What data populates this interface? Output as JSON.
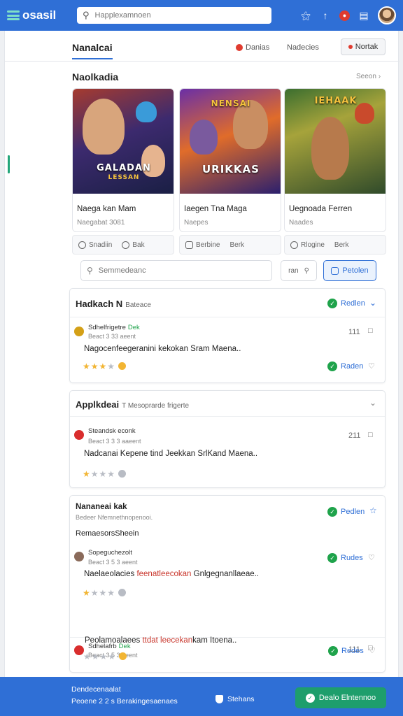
{
  "topbar": {
    "logo": "osasil",
    "search_placeholder": "Happlexamnoen",
    "notif_count": "1"
  },
  "subnav": {
    "title": "Nanalcai",
    "tab1": "Danias",
    "tab2": "Nadecies",
    "button": "Nortak"
  },
  "featured": {
    "heading": "Naolkadia",
    "see_all": "Seeon ›",
    "cards": [
      {
        "art_title": "GALADAN",
        "art_sub": "LESSAN",
        "name": "Naega kan Mam",
        "sub": "Naegabat 3081",
        "action1": "Snadiin",
        "action2": "Bak"
      },
      {
        "art_title": "URIKKAS",
        "art_sub": "NENSAI",
        "name": "Iaegen Tna Maga",
        "sub": "Naepes",
        "action1": "Berbine",
        "action2": "Berk"
      },
      {
        "art_title": "IEHAAK",
        "art_sub": "",
        "name": "Uegnoada Ferren",
        "sub": "Naades",
        "action1": "Rlogine",
        "action2": "Berk"
      }
    ]
  },
  "toolbar": {
    "search_placeholder": "Semmedeanc",
    "filter_label": "ran",
    "preview_label": "Petolen"
  },
  "panel1": {
    "title": "Hadkach N",
    "tag": "Bateace",
    "status": "Redlen",
    "review": {
      "name": "Sdhelfrigetre",
      "name_tag": "Dek",
      "meta": "Beact 3 33 aeent",
      "text": "Nagocenfeegeranini kekokan Sram Maena..",
      "count": "111",
      "status": "Raden",
      "stars": 3
    }
  },
  "panel2": {
    "title": "Applkdeai",
    "tag": "T   Mesoprarde frigerte",
    "review": {
      "name": "Steandsk econk",
      "meta": "Beact 3 3 3 aaeent",
      "text": "Nadcanai Kepene tind Jeekkan SrlKand Maena..",
      "count": "211",
      "stars": 1
    }
  },
  "panel3": {
    "title": "Nananeai kak",
    "meta": "Bedeer  Nfemnethnopenooi.",
    "heading": "RemaesorsSheein",
    "status": "Pedlen",
    "review1": {
      "name": "Sopeguchezolt",
      "meta": "Beact 3 5 3 aeent",
      "text_a": "Naelaeolacies ",
      "text_hl": "feenatleecokan",
      "text_b": " Gnlgegnanllaeae..",
      "status": "Rudes",
      "stars": 1
    },
    "review2": {
      "name": "Sdhelafrb",
      "name_tag": "Dek",
      "meta": "Beact 3 5 3 aeent",
      "text_a": "Peolamoalaees ",
      "text_hl": "ttdat leecekan",
      "text_b": "kam Itoena..",
      "count": "111",
      "status": "Redes",
      "stars": 3
    }
  },
  "bottombar": {
    "line1": "Dendecenaalat",
    "line2": "Peoene 2  2 s  Berakingesaenaes",
    "mid": "Stehans",
    "button": "Dealo Elntennoo"
  },
  "colors": {
    "brand": "#2f6fd6",
    "success": "#1fa34b",
    "accent": "#1e9e6c",
    "alert": "#e03b2f",
    "star": "#f2b533"
  }
}
